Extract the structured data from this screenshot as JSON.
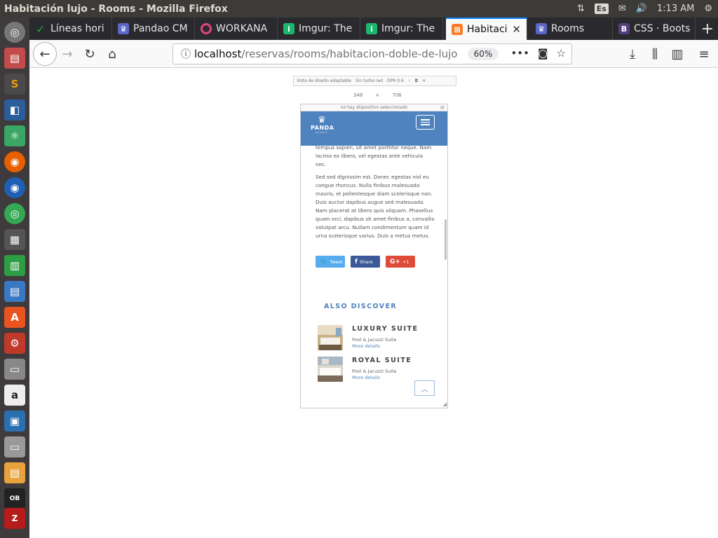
{
  "window": {
    "title": "Habitación lujo - Rooms - Mozilla Firefox",
    "keyboard_layout": "Es",
    "clock": "1:13 AM"
  },
  "tabs": [
    {
      "label": "Líneas hori",
      "icon": "checkmark-icon",
      "color": "#1aa34a"
    },
    {
      "label": "Pandao CM",
      "icon": "crown-icon",
      "color": "#5a67c6"
    },
    {
      "label": "WORKANA",
      "icon": "workana-icon",
      "color": "#e0457b"
    },
    {
      "label": "Imgur: The",
      "icon": "imgur-icon",
      "color": "#1bb76e"
    },
    {
      "label": "Imgur: The",
      "icon": "imgur-icon",
      "color": "#1bb76e"
    },
    {
      "label": "Habitaci",
      "icon": "xampp-icon",
      "color": "#fb7a24",
      "active": true
    },
    {
      "label": "Rooms",
      "icon": "crown-icon",
      "color": "#5a67c6"
    },
    {
      "label": "CSS · Boots",
      "icon": "bootstrap-icon",
      "color": "#563d7c"
    }
  ],
  "navbar": {
    "url_host": "localhost",
    "url_path": "/reservas/rooms/habitacion-doble-de-lujo",
    "zoom": "60%"
  },
  "rdm": {
    "mode_label": "Vista de diseño adaptable",
    "throttle_label": "Sin turbo red",
    "dpr_label": "DPR 0.6",
    "width": "348",
    "times": "×",
    "height": "706",
    "device_label": "no hay dispositivo seleccionado"
  },
  "site": {
    "brand": "PANDA",
    "brand_sub": "RESORT",
    "para1": "tempus sapien, sit amet porttitor neque. Nam lacinia ex libero, vel egestas ante vehicula nec.",
    "para2": "Sed sed dignissim est. Donec egestas nisl eu congue rhoncus. Nulla finibus malesuada mauris, et pellentesque diam scelerisque non. Duis auctor dapibus augue sed malesuada. Nam placerat at libero quis aliquam. Phasellus quam orci, dapibus sit amet finibus a, convallis volutpat arcu. Nullam condimentum quam id urna scelerisque varius. Duis a metus metus.",
    "share": {
      "tweet": "Tweet",
      "facebook": "Share",
      "google": "+1"
    },
    "also_discover": "ALSO DISCOVER",
    "rooms": [
      {
        "name": "LUXURY SUITE",
        "features": "Pool & Jacuzzi Suite",
        "more": "More details"
      },
      {
        "name": "ROYAL SUITE",
        "features": "Pool & Jacuzzi Suite",
        "more": "More details"
      }
    ]
  },
  "colors": {
    "brand_blue": "#4f83bf",
    "twitter": "#55acee",
    "facebook": "#3b5998",
    "google": "#dd4b39"
  }
}
